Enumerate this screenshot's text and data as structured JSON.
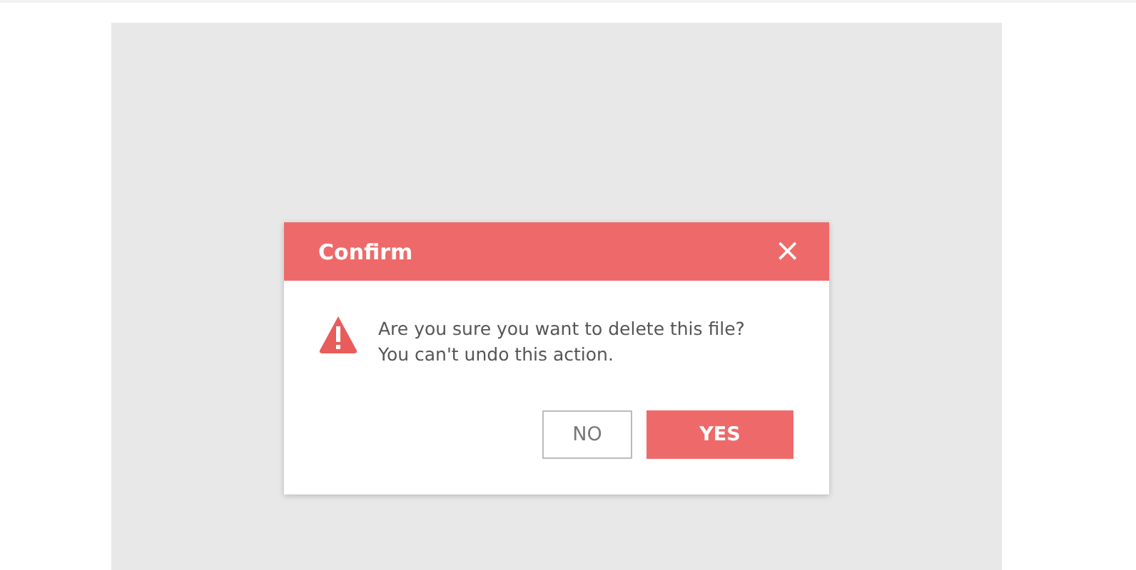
{
  "dialog": {
    "title": "Confirm",
    "close": "×",
    "message": [
      "Are you sure you want to delete this file?",
      "You can't undo this action."
    ],
    "buttons": [
      {
        "label": "NO",
        "kind": "secondary"
      },
      {
        "label": "YES",
        "kind": "primary"
      }
    ]
  }
}
